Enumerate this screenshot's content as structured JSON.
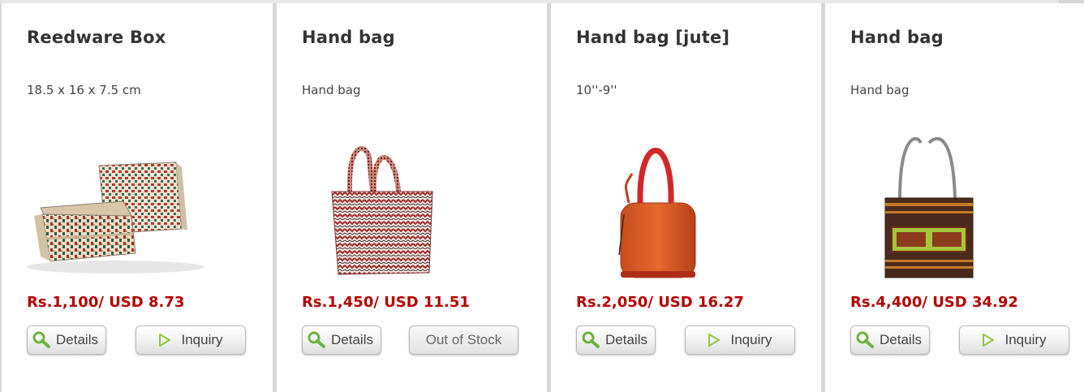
{
  "products": [
    {
      "title": "Reedware Box",
      "description": "18.5 x 16 x 7.5 cm",
      "price": "Rs.1,100/ USD 8.73",
      "details_label": "Details",
      "action_label": "Inquiry",
      "action_type": "inquiry",
      "image": "reedware-box"
    },
    {
      "title": "Hand bag",
      "description": "Hand bag",
      "price": "Rs.1,450/ USD 11.51",
      "details_label": "Details",
      "action_label": "Out of Stock",
      "action_type": "out-of-stock",
      "image": "woven-handbag"
    },
    {
      "title": "Hand bag [jute]",
      "description": "10''-9''",
      "price": "Rs.2,050/ USD 16.27",
      "details_label": "Details",
      "action_label": "Inquiry",
      "action_type": "inquiry",
      "image": "jute-handbag"
    },
    {
      "title": "Hand bag",
      "description": "Hand bag",
      "price": "Rs.4,400/ USD 34.92",
      "details_label": "Details",
      "action_label": "Inquiry",
      "action_type": "inquiry",
      "image": "elephant-handbag"
    }
  ],
  "colors": {
    "price": "#b50000",
    "title": "#333333",
    "magnifier": "#6db33f",
    "play": "#8cc63f"
  },
  "icons": {
    "details": "magnifier-icon",
    "inquiry": "play-triangle-icon"
  }
}
